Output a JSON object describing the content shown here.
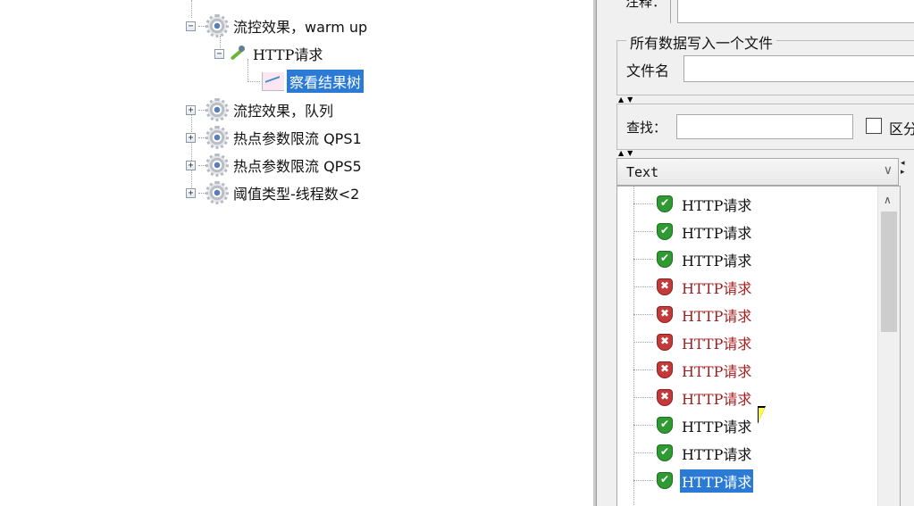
{
  "tree": {
    "nodes": [
      {
        "label": "流控效果，warm up",
        "expander": "−"
      },
      {
        "label": "HTTP请求",
        "expander": "−"
      },
      {
        "label": "察看结果树"
      },
      {
        "label": "流控效果，队列",
        "expander": "+"
      },
      {
        "label": "热点参数限流 QPS1",
        "expander": "+"
      },
      {
        "label": "热点参数限流 QPS5",
        "expander": "+"
      },
      {
        "label": "阈值类型-线程数<2",
        "expander": "+"
      }
    ]
  },
  "panel": {
    "comment_label": "注释：",
    "group_title": "所有数据写入一个文件",
    "filename_label": "文件名",
    "filename_value": "",
    "search_label": "查找：",
    "search_value": "",
    "case_label": "区分",
    "splitter_arrows": "▲▼",
    "renderer": {
      "selected": "Text",
      "arrow": "∨"
    }
  },
  "results": {
    "items": [
      {
        "label": "HTTP请求",
        "status": "ok"
      },
      {
        "label": "HTTP请求",
        "status": "ok"
      },
      {
        "label": "HTTP请求",
        "status": "ok"
      },
      {
        "label": "HTTP请求",
        "status": "error"
      },
      {
        "label": "HTTP请求",
        "status": "error"
      },
      {
        "label": "HTTP请求",
        "status": "error"
      },
      {
        "label": "HTTP请求",
        "status": "error"
      },
      {
        "label": "HTTP请求",
        "status": "error"
      },
      {
        "label": "HTTP请求",
        "status": "ok"
      },
      {
        "label": "HTTP请求",
        "status": "ok"
      },
      {
        "label": "HTTP请求",
        "status": "ok",
        "selected": true
      }
    ],
    "scroll_up": "∧",
    "ok_mark": "✔",
    "err_mark": "✖"
  },
  "colors": {
    "selection": "#2b7bd6",
    "ok_shield": "#2f9a32",
    "error_shield": "#c33a3a",
    "error_text": "#a31f1f"
  },
  "icons": {
    "test_group": "gear-icon",
    "sampler": "pipette-icon",
    "listener": "graph-icon",
    "success": "green-shield-check-icon",
    "failure": "red-shield-cross-icon"
  }
}
